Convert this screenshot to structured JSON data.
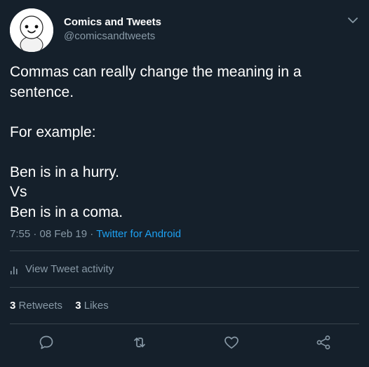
{
  "author": {
    "display_name": "Comics and Tweets",
    "handle": "@comicsandtweets",
    "avatar_icon": "smiling-character-avatar"
  },
  "tweet": {
    "lines": [
      "Commas can really change the meaning in a",
      "sentence.",
      "",
      "For example:",
      "",
      "Ben is in a hurry.",
      "Vs",
      "Ben is in a coma."
    ]
  },
  "meta": {
    "time": "7:55",
    "date": "08 Feb 19",
    "separator": "·",
    "source": "Twitter for Android"
  },
  "activity": {
    "label": "View Tweet activity",
    "icon": "bar-chart-icon"
  },
  "stats": {
    "retweets_count": "3",
    "retweets_label": "Retweets",
    "likes_count": "3",
    "likes_label": "Likes"
  },
  "actions": {
    "reply_icon": "comment-icon",
    "retweet_icon": "retweet-icon",
    "like_icon": "heart-icon",
    "share_icon": "share-icon"
  },
  "colors": {
    "background": "#15202b",
    "primary_text": "#ffffff",
    "secondary_text": "#8899a6",
    "accent": "#1da1f2",
    "divider": "#38444d"
  }
}
